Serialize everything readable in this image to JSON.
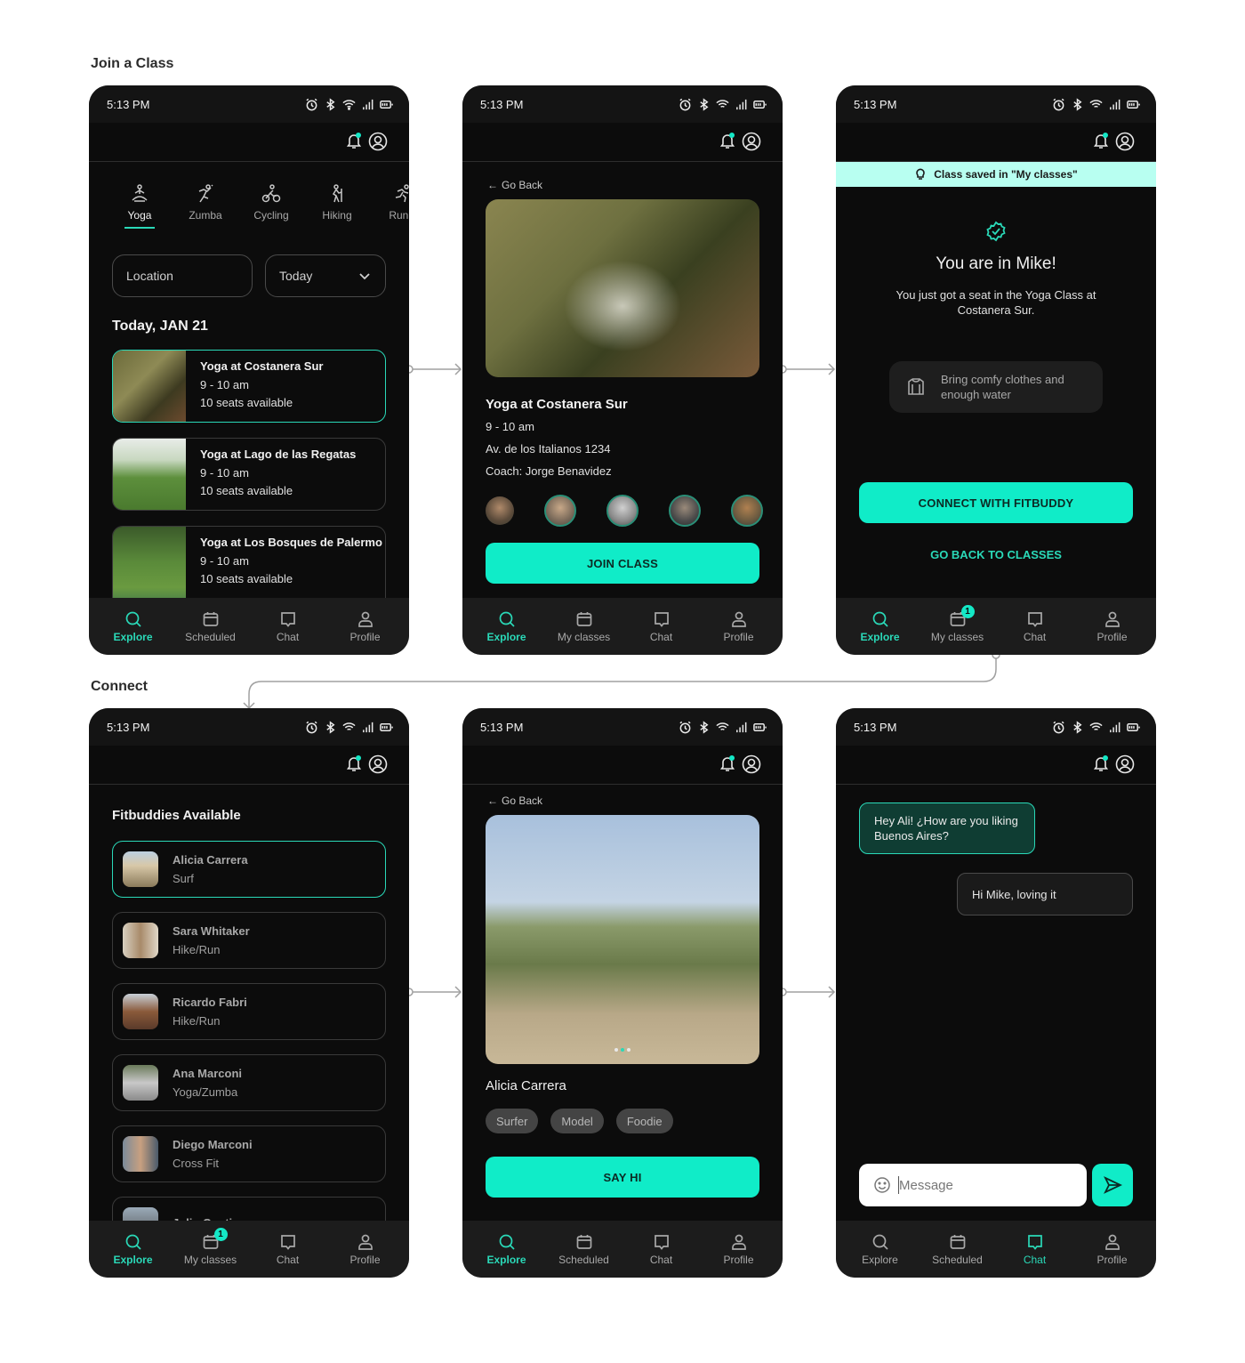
{
  "sections": {
    "join": "Join a Class",
    "connect": "Connect"
  },
  "status": {
    "time": "5:13 PM"
  },
  "colors": {
    "accent": "#10ecc8",
    "accent_text": "#2ad9b8",
    "toast_bg": "#b8fff1",
    "bg": "#0c0c0c",
    "nav_bg": "#1c1c1c"
  },
  "screen1": {
    "categories": [
      {
        "label": "Yoga",
        "icon": "yoga-icon",
        "active": true
      },
      {
        "label": "Zumba",
        "icon": "zumba-icon"
      },
      {
        "label": "Cycling",
        "icon": "cycling-icon"
      },
      {
        "label": "Hiking",
        "icon": "hiking-icon"
      },
      {
        "label": "Runni",
        "icon": "running-icon"
      }
    ],
    "location_placeholder": "Location",
    "date_select": "Today",
    "date_heading": "Today, JAN 21",
    "classes": [
      {
        "name": "Yoga at Costanera Sur",
        "time": "9 - 10 am",
        "seats": "10 seats available"
      },
      {
        "name": "Yoga at Lago de las Regatas",
        "time": "9 - 10 am",
        "seats": "10 seats available"
      },
      {
        "name": "Yoga at Los Bosques de Palermo",
        "time": "9 - 10 am",
        "seats": "10 seats available"
      }
    ],
    "nav": [
      "Explore",
      "Scheduled",
      "Chat",
      "Profile"
    ]
  },
  "screen2": {
    "go_back": "Go Back",
    "title": "Yoga at Costanera Sur",
    "time": "9 - 10 am",
    "address": "Av. de los Italianos 1234",
    "coach": "Coach: Jorge  Benavidez",
    "cta": "JOIN CLASS",
    "nav": [
      "Explore",
      "My classes",
      "Chat",
      "Profile"
    ]
  },
  "screen3": {
    "toast": "Class saved in \"My classes\"",
    "title": "You are in Mike!",
    "subtitle": "You just got a seat in the Yoga Class at Costanera Sur.",
    "tip": "Bring comfy clothes and enough water",
    "cta": "CONNECT WITH FITBUDDY",
    "secondary": "GO BACK TO CLASSES",
    "nav": [
      "Explore",
      "My classes",
      "Chat",
      "Profile"
    ],
    "badge": "1"
  },
  "screen4": {
    "heading": "Fitbuddies Available",
    "buddies": [
      {
        "name": "Alicia Carrera",
        "sport": "Surf"
      },
      {
        "name": "Sara Whitaker",
        "sport": "Hike/Run"
      },
      {
        "name": "Ricardo Fabri",
        "sport": "Hike/Run"
      },
      {
        "name": "Ana Marconi",
        "sport": "Yoga/Zumba"
      },
      {
        "name": "Diego Marconi",
        "sport": "Cross Fit"
      },
      {
        "name": "Julio Conti",
        "sport": ""
      }
    ],
    "nav": [
      "Explore",
      "My classes",
      "Chat",
      "Profile"
    ],
    "badge": "1"
  },
  "screen5": {
    "go_back": "Go Back",
    "name": "Alicia Carrera",
    "tags": [
      "Surfer",
      "Model",
      "Foodie"
    ],
    "cta": "SAY HI",
    "nav": [
      "Explore",
      "Scheduled",
      "Chat",
      "Profile"
    ]
  },
  "screen6": {
    "messages": [
      {
        "from": "me",
        "text": "Hey Ali! ¿How are you liking Buenos Aires?"
      },
      {
        "from": "them",
        "text": "Hi Mike, loving it"
      }
    ],
    "input_placeholder": "Message",
    "nav": [
      "Explore",
      "Scheduled",
      "Chat",
      "Profile"
    ]
  }
}
